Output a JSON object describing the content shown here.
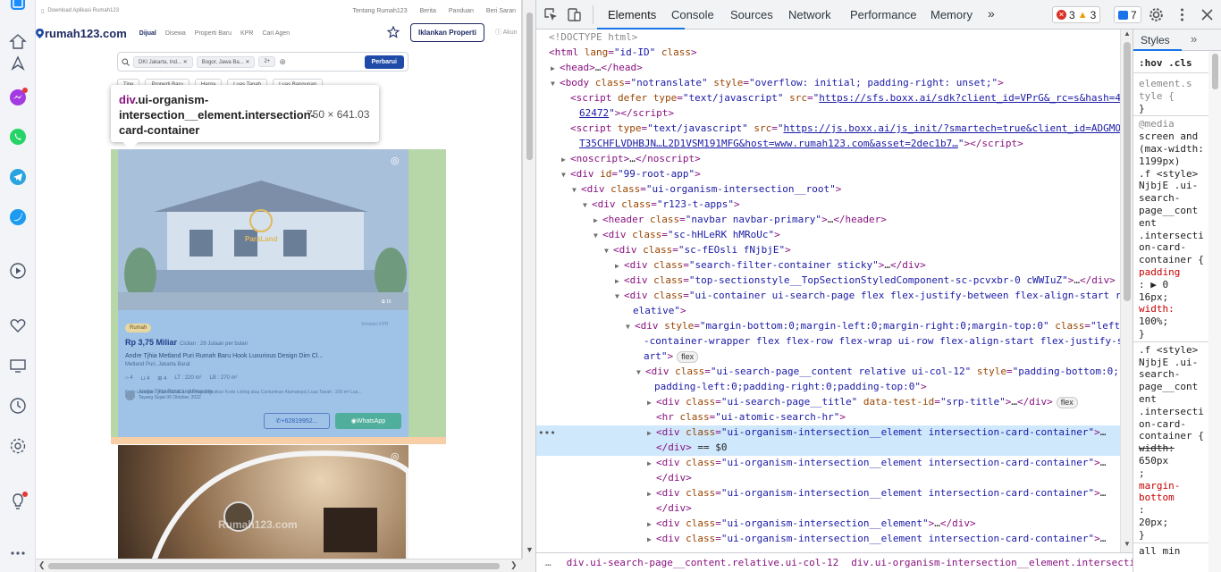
{
  "website": {
    "top_strip": {
      "download": "Download Aplikasi Rumah123",
      "links": [
        "Tentang Rumah123",
        "Berita",
        "Panduan",
        "Beri Saran"
      ]
    },
    "logo": "rumah123.com",
    "nav": [
      "Dijual",
      "Disewa",
      "Properti Baru",
      "KPR",
      "Cari Agen"
    ],
    "iklankan": "Iklankan Properti",
    "akun": "Akun",
    "search_chips": [
      "DKI Jakarta, Ind...",
      "Bogor, Jawa Ba...",
      "2+"
    ],
    "perbarui": "Perbarui",
    "filters": [
      "Tipe",
      "Properti Baru",
      "Harga",
      "Luas Tanah",
      "Luas Bangunan"
    ],
    "tooltip": {
      "tag": "div",
      "selector": ".ui-organism-intersection__element.intersection-card-container",
      "dims": "750 × 641.03"
    },
    "card1": {
      "watermark": "ParaLand",
      "photo_count": "⧉ 15",
      "badge": "Rumah",
      "simulasi": "Simulasi KPR",
      "price": "Rp 3,75 Miliar",
      "installment": "Cicilan : 29 Jutaan per bulan",
      "title": "Andre Tjhia Metland Puri Rumah Baru Hook Luxurious Design Dim Cl...",
      "location": "Metland Puri, Jakarta Barat",
      "specs": [
        "4",
        "4",
        "4",
        "LT : 220 m²",
        "LB : 270 m²"
      ],
      "kode": "Kode Listingan : R1A6821421 · (Mohon Sebutkan Kode Listing atau Cantumkan Alamatnya) Luas Tanah : 220 m² Lua...",
      "agent": "Andre Tjhia ParaLand Property",
      "agent_sub": "Tayang Sejak 06 Oktober, 2022",
      "call": "+62819952...",
      "whatsapp": "WhatsApp"
    },
    "card2": {
      "watermark": "Rumah123.com"
    }
  },
  "devtools": {
    "tabs": [
      "Elements",
      "Console",
      "Sources",
      "Network",
      "Performance",
      "Memory",
      "»"
    ],
    "errors": "3",
    "warnings": "3",
    "messages": "7",
    "dom_lines": [
      {
        "indent": 0,
        "tri": "",
        "html": "<span class='grey'>&lt;!DOCTYPE html&gt;</span>"
      },
      {
        "indent": 0,
        "tri": "",
        "html": "<span class='t'>&lt;html</span> <span class='a'>lang</span>=<span class='v'>\"id-ID\"</span> <span class='a'>class</span><span class='t'>&gt;</span>"
      },
      {
        "indent": 1,
        "tri": "▶",
        "html": "<span class='t'>&lt;head&gt;</span><span class='c'>…</span><span class='t'>&lt;/head&gt;</span>"
      },
      {
        "indent": 1,
        "tri": "▼",
        "html": "<span class='t'>&lt;body</span> <span class='a'>class</span>=<span class='v'>\"notranslate\"</span> <span class='a'>style</span>=<span class='v'>\"overflow: initial; padding-right: unset;\"</span><span class='t'>&gt;</span>"
      },
      {
        "indent": 2,
        "tri": "",
        "html": "<span class='t'>&lt;script</span> <span class='a'>defer</span> <span class='a'>type</span>=<span class='v'>\"text/javascript\"</span> <span class='a'>src</span>=<span class='v'>\"</span><span class='u'>https://sfs.boxx.ai/sdk?client_id=VPrG&amp;_rc=s&amp;hash=4</span>"
      },
      {
        "indent": 2,
        "tri": "",
        "html": "<span class='u'>62472</span><span class='v'>\"</span><span class='t'>&gt;&lt;/script&gt;</span>"
      },
      {
        "indent": 2,
        "tri": "",
        "html": "<span class='t'>&lt;script</span> <span class='a'>type</span>=<span class='v'>\"text/javascript\"</span> <span class='a'>src</span>=<span class='v'>\"</span><span class='u'>https://js.boxx.ai/js_init/?smartech=true&amp;client_id=ADGMO</span>"
      },
      {
        "indent": 2,
        "tri": "",
        "html": "<span class='u'>T35CHFLVDHBJN…L2D1VSM191MFG&amp;host=www.rumah123.com&amp;asset=2dec1b7…</span><span class='v'>\"</span><span class='t'>&gt;&lt;/script&gt;</span>"
      },
      {
        "indent": 2,
        "tri": "▶",
        "html": "<span class='t'>&lt;noscript&gt;</span><span class='c'>…</span><span class='t'>&lt;/noscript&gt;</span>"
      },
      {
        "indent": 2,
        "tri": "▼",
        "html": "<span class='t'>&lt;div</span> <span class='a'>id</span>=<span class='v'>\"99-root-app\"</span><span class='t'>&gt;</span>"
      },
      {
        "indent": 3,
        "tri": "▼",
        "html": "<span class='t'>&lt;div</span> <span class='a'>class</span>=<span class='v'>\"ui-organism-intersection__root\"</span><span class='t'>&gt;</span>"
      },
      {
        "indent": 4,
        "tri": "▼",
        "html": "<span class='t'>&lt;div</span> <span class='a'>class</span>=<span class='v'>\"r123-t-apps\"</span><span class='t'>&gt;</span>"
      },
      {
        "indent": 5,
        "tri": "▶",
        "html": "<span class='t'>&lt;header</span> <span class='a'>class</span>=<span class='v'>\"navbar navbar-primary\"</span><span class='t'>&gt;</span><span class='c'>…</span><span class='t'>&lt;/header&gt;</span>"
      },
      {
        "indent": 5,
        "tri": "▼",
        "html": "<span class='t'>&lt;div</span> <span class='a'>class</span>=<span class='v'>\"sc-hHLeRK hMRoUc\"</span><span class='t'>&gt;</span>"
      },
      {
        "indent": 6,
        "tri": "▼",
        "html": "<span class='t'>&lt;div</span> <span class='a'>class</span>=<span class='v'>\"sc-fEOsli fNjbjE\"</span><span class='t'>&gt;</span>"
      },
      {
        "indent": 7,
        "tri": "▶",
        "html": "<span class='t'>&lt;div</span> <span class='a'>class</span>=<span class='v'>\"search-filter-container sticky\"</span><span class='t'>&gt;</span><span class='c'>…</span><span class='t'>&lt;/div&gt;</span>"
      },
      {
        "indent": 7,
        "tri": "▶",
        "html": "<span class='t'>&lt;div</span> <span class='a'>class</span>=<span class='v'>\"top-sectionstyle__TopSectionStyledComponent-sc-pcvxbr-0 cWWIuZ\"</span><span class='t'>&gt;</span><span class='c'>…</span><span class='t'>&lt;/div&gt;</span>"
      },
      {
        "indent": 7,
        "tri": "▼",
        "html": "<span class='t'>&lt;div</span> <span class='a'>class</span>=<span class='v'>\"ui-container ui-search-page flex flex-justify-between flex-align-start r</span>"
      },
      {
        "indent": 7,
        "tri": "",
        "html": "<span class='v'>elative\"</span><span class='t'>&gt;</span>"
      },
      {
        "indent": 8,
        "tri": "▼",
        "html": "<span class='t'>&lt;div</span> <span class='a'>style</span>=<span class='v'>\"margin-bottom:0;margin-left:0;margin-right:0;margin-top:0\"</span> <span class='a'>class</span>=<span class='v'>\"left</span>"
      },
      {
        "indent": 8,
        "tri": "",
        "html": "<span class='v'>-container-wrapper flex flex-row flex-wrap ui-row flex-align-start flex-justify-st</span>"
      },
      {
        "indent": 8,
        "tri": "",
        "html": "<span class='v'>art\"</span><span class='t'>&gt;</span><span class='pill'>flex</span>"
      },
      {
        "indent": 9,
        "tri": "▼",
        "html": "<span class='t'>&lt;div</span> <span class='a'>class</span>=<span class='v'>\"ui-search-page__content relative ui-col-12\"</span> <span class='a'>style</span>=<span class='v'>\"padding-bottom:0;</span>"
      },
      {
        "indent": 9,
        "tri": "",
        "html": "<span class='v'>padding-left:0;padding-right:0;padding-top:0\"</span><span class='t'>&gt;</span>"
      },
      {
        "indent": 10,
        "tri": "▶",
        "html": "<span class='t'>&lt;div</span> <span class='a'>class</span>=<span class='v'>\"ui-search-page__title\"</span> <span class='a'>data-test-id</span>=<span class='v'>\"srp-title\"</span><span class='t'>&gt;</span><span class='c'>…</span><span class='t'>&lt;/div&gt;</span><span class='pill'>flex</span>"
      },
      {
        "indent": 10,
        "tri": "",
        "html": "<span class='t'>&lt;hr</span> <span class='a'>class</span>=<span class='v'>\"ui-atomic-search-hr\"</span><span class='t'>&gt;</span>"
      },
      {
        "indent": 10,
        "tri": "▶",
        "html": "<span class='t'>&lt;div</span> <span class='a'>class</span>=<span class='v'>\"ui-organism-intersection__element intersection-card-container\"</span><span class='t'>&gt;</span><span class='c'>…</span>"
      },
      {
        "indent": 10,
        "tri": "",
        "html": "<span class='t'>&lt;/div&gt;</span> <span class='c'>== $0</span>"
      },
      {
        "indent": 10,
        "tri": "▶",
        "html": "<span class='t'>&lt;div</span> <span class='a'>class</span>=<span class='v'>\"ui-organism-intersection__element intersection-card-container\"</span><span class='t'>&gt;</span><span class='c'>…</span>"
      },
      {
        "indent": 10,
        "tri": "",
        "html": "<span class='t'>&lt;/div&gt;</span>"
      },
      {
        "indent": 10,
        "tri": "▶",
        "html": "<span class='t'>&lt;div</span> <span class='a'>class</span>=<span class='v'>\"ui-organism-intersection__element intersection-card-container\"</span><span class='t'>&gt;</span><span class='c'>…</span>"
      },
      {
        "indent": 10,
        "tri": "",
        "html": "<span class='t'>&lt;/div&gt;</span>"
      },
      {
        "indent": 10,
        "tri": "▶",
        "html": "<span class='t'>&lt;div</span> <span class='a'>class</span>=<span class='v'>\"ui-organism-intersection__element\"</span><span class='t'>&gt;</span><span class='c'>…</span><span class='t'>&lt;/div&gt;</span>"
      },
      {
        "indent": 10,
        "tri": "▶",
        "html": "<span class='t'>&lt;div</span> <span class='a'>class</span>=<span class='v'>\"ui-organism-intersection__element intersection-card-container\"</span><span class='t'>&gt;</span><span class='c'>…</span>"
      }
    ],
    "breadcrumbs": [
      "div.ui-search-page__content.relative.ui-col-12",
      "div.ui-organism-intersection__element.intersection-card-container"
    ],
    "styles": {
      "tab": "Styles",
      "filter": ":hov .cls",
      "lines": [
        {
          "cls": "grey",
          "text": "element.s"
        },
        {
          "cls": "grey",
          "text": "tyle {"
        },
        {
          "cls": "",
          "text": "}"
        },
        {
          "cls": "grey",
          "text": "@media"
        },
        {
          "cls": "",
          "text": "screen and"
        },
        {
          "cls": "",
          "text": "(max-width:"
        },
        {
          "cls": "",
          "text": "1199px)"
        },
        {
          "cls": "",
          "text": ".f   <style>"
        },
        {
          "cls": "",
          "text": "NjbjE .ui-"
        },
        {
          "cls": "",
          "text": "search-"
        },
        {
          "cls": "",
          "text": "page__cont"
        },
        {
          "cls": "",
          "text": "ent"
        },
        {
          "cls": "",
          "text": ".intersecti"
        },
        {
          "cls": "",
          "text": "on-card-"
        },
        {
          "cls": "",
          "text": "container {"
        },
        {
          "cls": "prop",
          "text": "  padding"
        },
        {
          "cls": "",
          "text": "  : ▶ 0"
        },
        {
          "cls": "",
          "text": "  16px;"
        },
        {
          "cls": "prop",
          "text": "  width:"
        },
        {
          "cls": "",
          "text": "  100%;"
        },
        {
          "cls": "",
          "text": "}"
        },
        {
          "cls": "",
          "text": ".f   <style>"
        },
        {
          "cls": "",
          "text": "NjbjE .ui-"
        },
        {
          "cls": "",
          "text": "search-"
        },
        {
          "cls": "",
          "text": "page__cont"
        },
        {
          "cls": "",
          "text": "ent"
        },
        {
          "cls": "",
          "text": ".intersecti"
        },
        {
          "cls": "",
          "text": "on-card-"
        },
        {
          "cls": "",
          "text": "container {"
        },
        {
          "cls": "strike",
          "text": "  width:"
        },
        {
          "cls": "",
          "text": "  650px"
        },
        {
          "cls": "",
          "text": "  ;"
        },
        {
          "cls": "prop",
          "text": "  margin-"
        },
        {
          "cls": "prop",
          "text": "  bottom"
        },
        {
          "cls": "",
          "text": "  :"
        },
        {
          "cls": "",
          "text": "  20px;"
        },
        {
          "cls": "",
          "text": "}"
        },
        {
          "cls": "",
          "text": "  all min"
        }
      ]
    }
  },
  "colors": {
    "devtools_accent": "#1a73e8",
    "tag": "#881280",
    "attr": "#994500",
    "value": "#1a1aa6",
    "highlight_content": "#9fc3e7",
    "highlight_padding": "#b7d7a8",
    "highlight_margin": "#f6c99c"
  }
}
